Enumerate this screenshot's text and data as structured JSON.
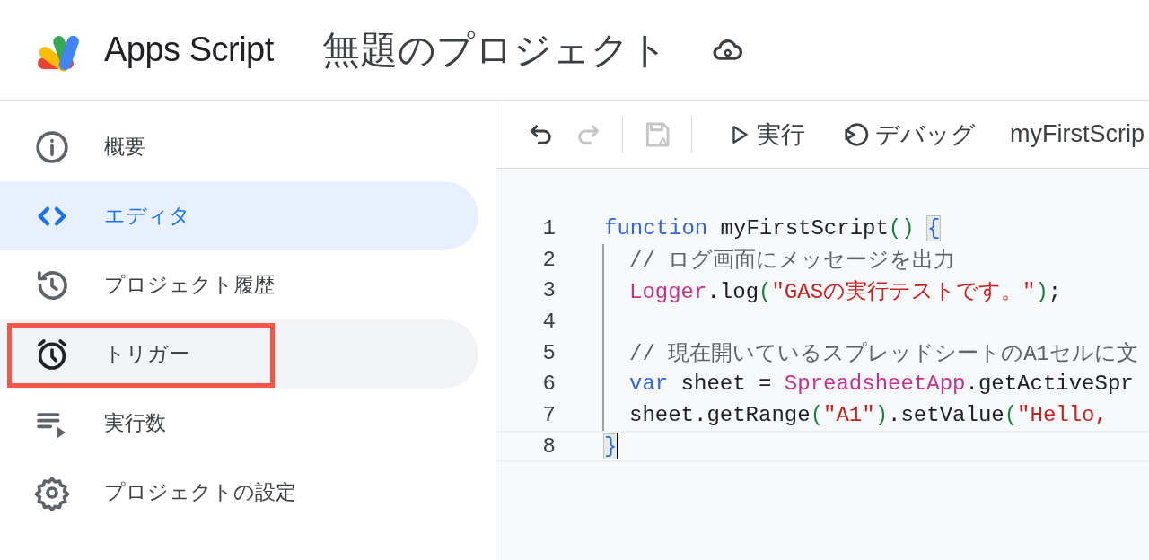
{
  "header": {
    "product": "Apps Script",
    "project_title": "無題のプロジェクト"
  },
  "sidebar": {
    "items": [
      {
        "kind": "overview",
        "label": "概要",
        "selected": false,
        "hovered": false,
        "highlighted": false
      },
      {
        "kind": "editor",
        "label": "エディタ",
        "selected": true,
        "hovered": false,
        "highlighted": false
      },
      {
        "kind": "history",
        "label": "プロジェクト履歴",
        "selected": false,
        "hovered": false,
        "highlighted": false
      },
      {
        "kind": "triggers",
        "label": "トリガー",
        "selected": false,
        "hovered": true,
        "highlighted": true
      },
      {
        "kind": "executions",
        "label": "実行数",
        "selected": false,
        "hovered": false,
        "highlighted": false
      },
      {
        "kind": "settings",
        "label": "プロジェクトの設定",
        "selected": false,
        "hovered": false,
        "highlighted": false
      }
    ]
  },
  "toolbar": {
    "icon_buttons": [
      {
        "kind": "undo",
        "disabled": false
      },
      {
        "kind": "redo",
        "disabled": true
      },
      {
        "kind": "save",
        "disabled": true
      }
    ],
    "run": "実行",
    "debug": "デバッグ",
    "function_select": "myFirstScrip"
  },
  "code": {
    "lines": [
      {
        "number": "1",
        "indented": false,
        "cursor": false,
        "tokens": [
          {
            "kind": "keyword",
            "text": "function"
          },
          {
            "kind": "plain",
            "text": " myFirstScript"
          },
          {
            "kind": "paren",
            "text": "() "
          },
          {
            "kind": "bracket_match",
            "text": "{"
          }
        ]
      },
      {
        "number": "2",
        "indented": true,
        "cursor": false,
        "tokens": [
          {
            "kind": "comment",
            "text": "// ログ画面にメッセージを出力"
          }
        ]
      },
      {
        "number": "3",
        "indented": true,
        "cursor": false,
        "tokens": [
          {
            "kind": "class",
            "text": "Logger"
          },
          {
            "kind": "plain",
            "text": ".log"
          },
          {
            "kind": "paren",
            "text": "("
          },
          {
            "kind": "string",
            "text": "\"GASの実行テストです。\""
          },
          {
            "kind": "paren",
            "text": ")"
          },
          {
            "kind": "plain",
            "text": ";"
          }
        ]
      },
      {
        "number": "4",
        "indented": true,
        "cursor": false
      },
      {
        "number": "5",
        "indented": true,
        "cursor": false,
        "tokens": [
          {
            "kind": "comment",
            "text": "// 現在開いているスプレッドシートのA1セルに文"
          }
        ]
      },
      {
        "number": "6",
        "indented": true,
        "cursor": false,
        "tokens": [
          {
            "kind": "keyword",
            "text": "var"
          },
          {
            "kind": "plain",
            "text": " sheet = "
          },
          {
            "kind": "class",
            "text": "SpreadsheetApp"
          },
          {
            "kind": "plain",
            "text": ".getActiveSpr"
          }
        ]
      },
      {
        "number": "7",
        "indented": true,
        "cursor": false,
        "tokens": [
          {
            "kind": "plain",
            "text": "sheet.getRange"
          },
          {
            "kind": "paren",
            "text": "("
          },
          {
            "kind": "string",
            "text": "\"A1\""
          },
          {
            "kind": "paren",
            "text": ")"
          },
          {
            "kind": "plain",
            "text": ".setValue"
          },
          {
            "kind": "paren",
            "text": "("
          },
          {
            "kind": "string",
            "text": "\"Hello,"
          }
        ]
      },
      {
        "number": "8",
        "indented": false,
        "cursor": true,
        "tokens": [
          {
            "kind": "bracket_match",
            "text": "}"
          }
        ]
      }
    ]
  }
}
